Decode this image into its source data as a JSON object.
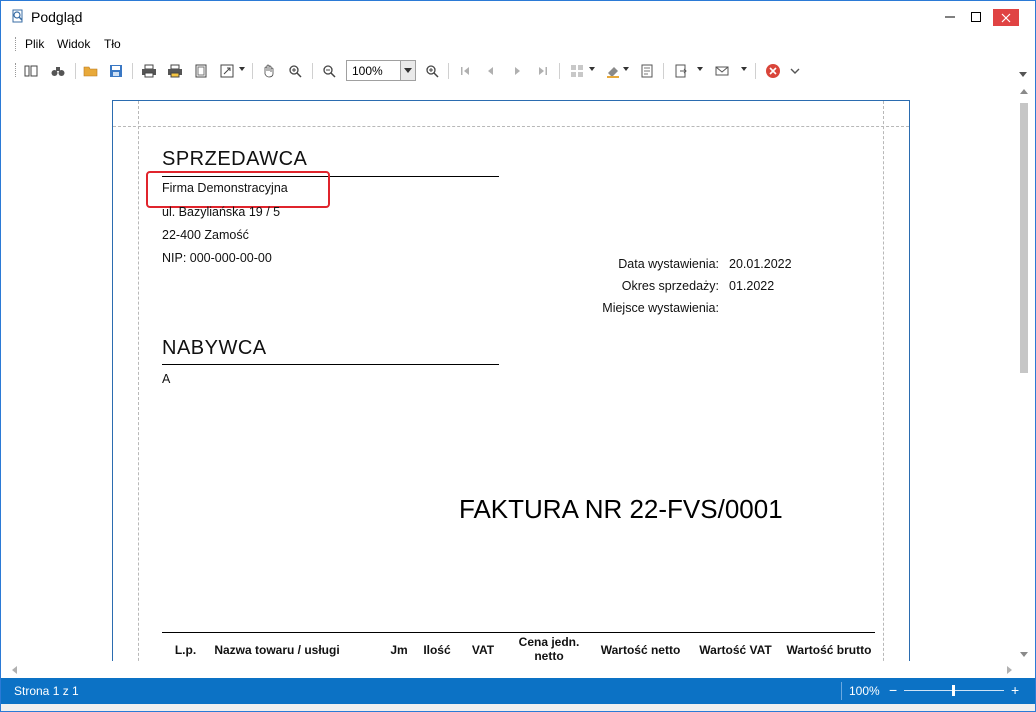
{
  "window": {
    "title": "Podgląd",
    "accent": "#0c72c5",
    "close_color": "#e04343"
  },
  "menu": {
    "items": [
      "Plik",
      "Widok",
      "Tło"
    ]
  },
  "toolbar": {
    "zoom_value": "100%",
    "icons": [
      "thumbnails-icon",
      "find-icon",
      "open-icon",
      "save-icon",
      "print-icon",
      "quick-print-icon",
      "page-setup-icon",
      "scale-icon",
      "hand-tool-icon",
      "magnifier-icon",
      "zoom-out-icon",
      "zoom-in-icon",
      "first-page-icon",
      "previous-page-icon",
      "next-page-icon",
      "last-page-icon",
      "multiple-pages-icon",
      "color-icon",
      "watermark-icon",
      "export-icon",
      "email-icon",
      "close-preview-icon",
      "more-icon"
    ]
  },
  "document": {
    "seller_heading": "SPRZEDAWCA",
    "seller_name": "Firma Demonstracyjna",
    "seller_street": "ul. Bazyliańska 19 / 5",
    "seller_city": "22-400 Zamość",
    "seller_nip": "NIP: 000-000-00-00",
    "issue_date_label": "Data wystawienia:",
    "issue_date_value": "20.01.2022",
    "sale_period_label": "Okres sprzedaży:",
    "sale_period_value": "01.2022",
    "issue_place_label": "Miejsce wystawienia:",
    "issue_place_value": "",
    "buyer_heading": "NABYWCA",
    "buyer_name": "A",
    "invoice_title": "FAKTURA NR 22-FVS/0001",
    "table_headers": {
      "lp": "L.p.",
      "name": "Nazwa towaru / usługi",
      "unit": "Jm",
      "qty": "Ilość",
      "vat": "VAT",
      "unit_price": "Cena jedn. netto",
      "net": "Wartość netto",
      "vat_value": "Wartość VAT",
      "gross": "Wartość brutto"
    },
    "highlight_color": "#e0242c"
  },
  "status": {
    "page": "Strona 1 z 1",
    "zoom": "100%",
    "zoom_level_percent": 100
  }
}
